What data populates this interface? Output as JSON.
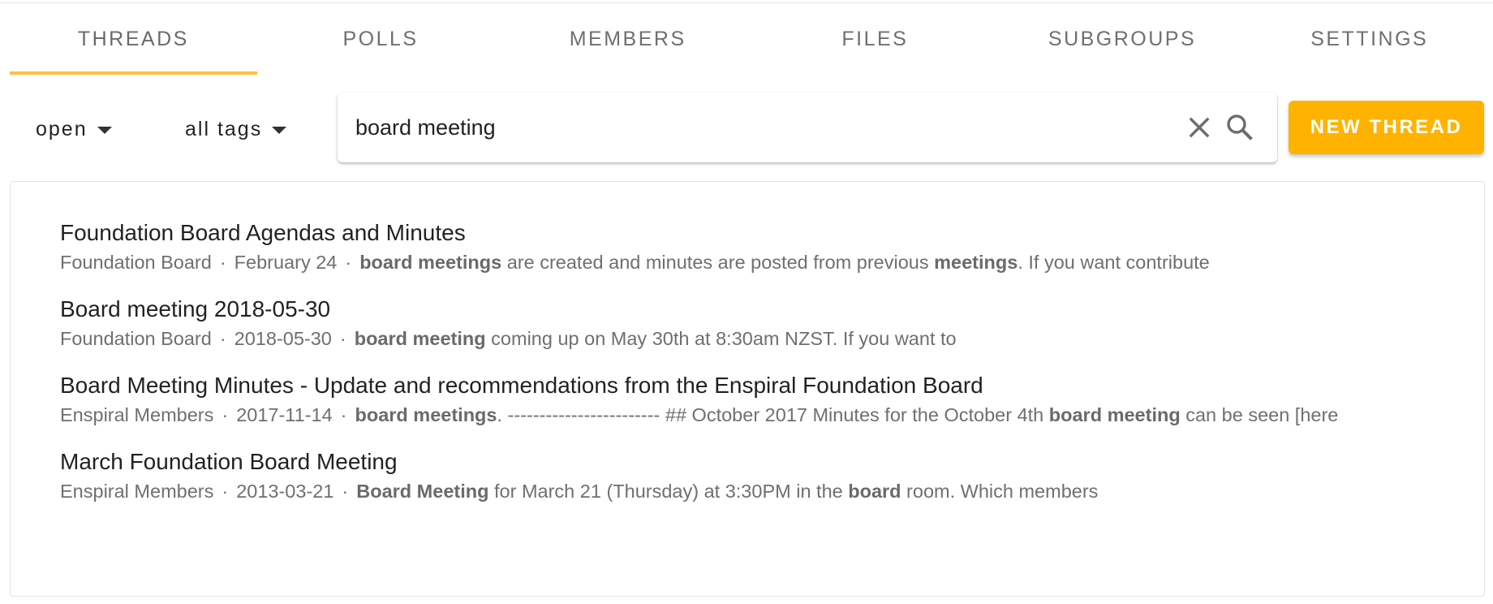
{
  "tabs": [
    {
      "label": "THREADS",
      "active": true
    },
    {
      "label": "POLLS",
      "active": false
    },
    {
      "label": "MEMBERS",
      "active": false
    },
    {
      "label": "FILES",
      "active": false
    },
    {
      "label": "SUBGROUPS",
      "active": false
    },
    {
      "label": "SETTINGS",
      "active": false
    }
  ],
  "filters": {
    "status": {
      "value": "open",
      "icon": "caret-down-icon"
    },
    "tags": {
      "value": "all tags",
      "icon": "caret-down-icon"
    }
  },
  "search": {
    "value": "board meeting",
    "clear_icon": "close-icon",
    "search_icon": "search-icon"
  },
  "new_thread_label": "NEW THREAD",
  "colors": {
    "accent": "#ffb300",
    "tab_underline": "#ffc13c"
  },
  "results": [
    {
      "title": "Foundation Board Agendas and Minutes",
      "group": "Foundation Board",
      "date": "February 24",
      "snippet": [
        {
          "text": "board meetings",
          "bold": true
        },
        {
          "text": " are created and minutes are posted from previous ",
          "bold": false
        },
        {
          "text": "meetings",
          "bold": true
        },
        {
          "text": ". If you want contribute",
          "bold": false
        }
      ]
    },
    {
      "title": "Board meeting 2018-05-30",
      "group": "Foundation Board",
      "date": "2018-05-30",
      "snippet": [
        {
          "text": "board meeting",
          "bold": true
        },
        {
          "text": " coming up on May 30th at 8:30am NZST. If you want to",
          "bold": false
        }
      ]
    },
    {
      "title": "Board Meeting Minutes - Update and recommendations from the Enspiral Foundation Board",
      "group": "Enspiral Members",
      "date": "2017-11-14",
      "snippet": [
        {
          "text": "board meetings",
          "bold": true
        },
        {
          "text": ". ------------------------ ## October 2017 Minutes for the October 4th ",
          "bold": false
        },
        {
          "text": "board meeting",
          "bold": true
        },
        {
          "text": " can be seen [here",
          "bold": false
        }
      ]
    },
    {
      "title": "March Foundation Board Meeting",
      "group": "Enspiral Members",
      "date": "2013-03-21",
      "snippet": [
        {
          "text": "Board Meeting",
          "bold": true
        },
        {
          "text": " for March 21 (Thursday) at 3:30PM in the ",
          "bold": false
        },
        {
          "text": "board",
          "bold": true
        },
        {
          "text": " room. Which members",
          "bold": false
        }
      ]
    }
  ],
  "separator": "·"
}
